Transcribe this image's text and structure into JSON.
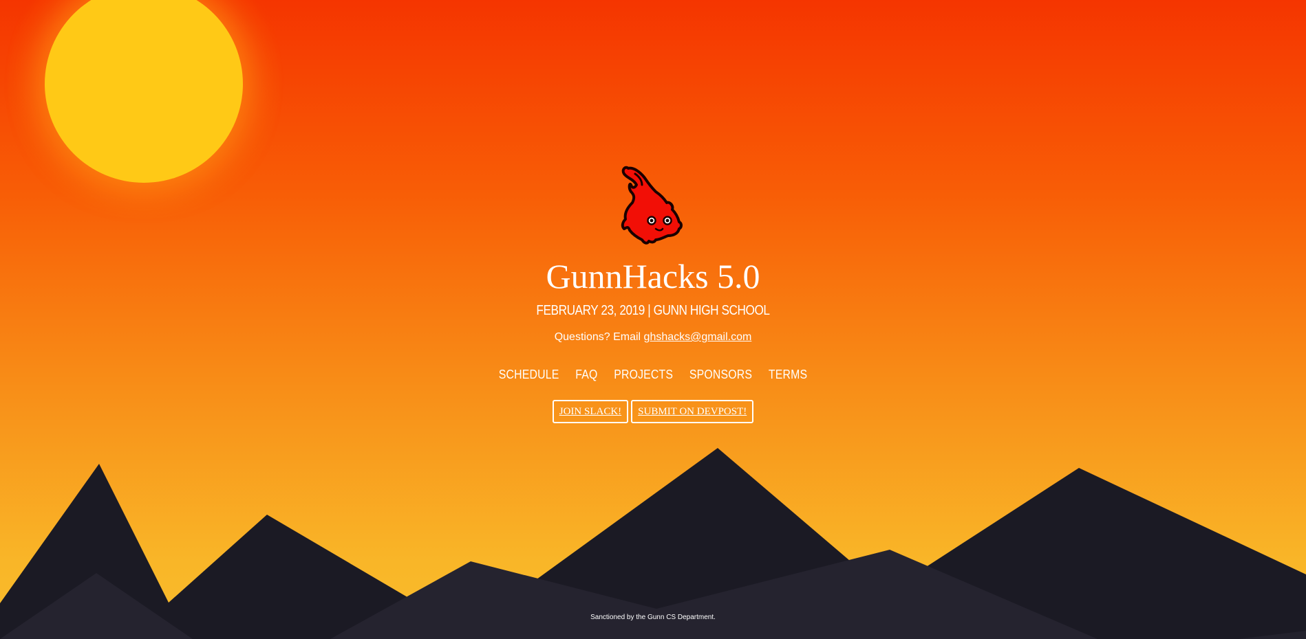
{
  "header": {
    "title": "GunnHacks 5.0",
    "date_line": "FEBRUARY 23, 2019 | GUNN HIGH SCHOOL"
  },
  "contact": {
    "prefix": "Questions? Email ",
    "email": "ghshacks@gmail.com"
  },
  "nav": {
    "items": [
      "SCHEDULE",
      "FAQ",
      "PROJECTS",
      "SPONSORS",
      "TERMS"
    ]
  },
  "buttons": {
    "slack": "JOIN SLACK!",
    "devpost": "SUBMIT ON DEVPOST!"
  },
  "footer": {
    "text": "Sanctioned by the Gunn CS Department."
  },
  "colors": {
    "sky_top": "#f53500",
    "sky_bottom": "#f9bd2c",
    "sun": "#ffc916",
    "mountain_dark": "#1b1a24",
    "mountain_front": "#25232f",
    "mascot_red": "#f20f06"
  },
  "icons": {
    "logo": "titan-flame-mascot-icon"
  }
}
